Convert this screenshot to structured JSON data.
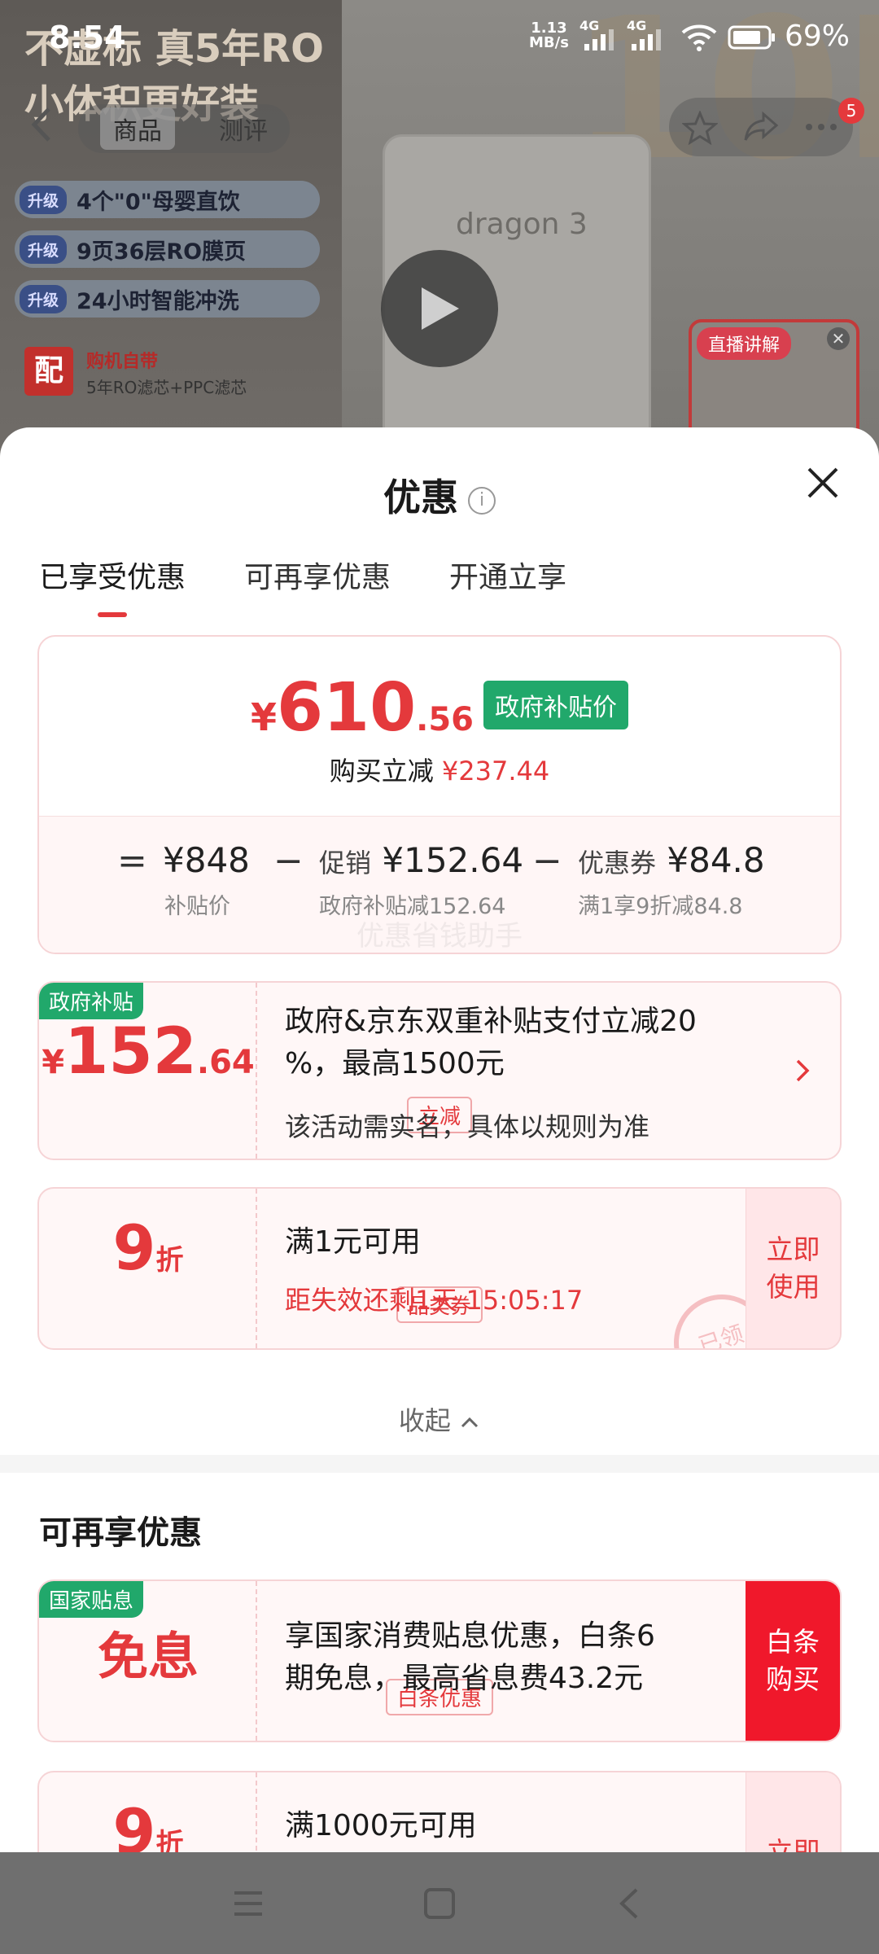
{
  "status_bar": {
    "time": "8:54",
    "net_speed": "1.13",
    "net_unit": "MB/s",
    "signal1": "4G",
    "signal2": "4G",
    "battery": "69%"
  },
  "product": {
    "poster_title_1": "不虚标 真5年RO",
    "poster_title_2": "小体积更好装",
    "features": [
      {
        "tag": "升级",
        "text": "4个\"0\"母婴直饮"
      },
      {
        "tag": "升级",
        "text": "9页36层RO膜页"
      },
      {
        "tag": "升级",
        "text": "24小时智能冲洗"
      }
    ],
    "gift_mark": "配",
    "gift_line1": "购机自带",
    "gift_line2": "5年RO滤芯+PPC滤芯",
    "device_label": "dragon 3",
    "nav_tabs": [
      "商品",
      "测评"
    ],
    "cart_badge": "5",
    "live_tag": "直播讲解"
  },
  "sheet": {
    "title": "优惠",
    "info_icon": "i",
    "tabs": [
      "已享受优惠",
      "可再享优惠",
      "开通立享"
    ],
    "active_tab": 0
  },
  "price": {
    "yen": "¥",
    "integer": "610",
    "decimal": ".56",
    "badge": "政府补贴价",
    "reduce_label": "购买立减",
    "reduce_amount": "¥237.44",
    "eq": "=",
    "minus": "−",
    "base_value": "¥848",
    "base_label": "补贴价",
    "promo_prefix": "促销",
    "promo_value": "¥152.64",
    "promo_label": "政府补贴减152.64",
    "coupon_prefix": "优惠券",
    "coupon_value": "¥84.8",
    "coupon_label": "满1享9折减84.8",
    "watermark": "优惠省钱助手"
  },
  "coupons": [
    {
      "tag": "政府补贴",
      "yen": "¥",
      "value_int": "152",
      "value_dec": ".64",
      "sub": "立减",
      "desc_line1": "政府&京东双重补贴支付立减20",
      "desc_line2": "%，最高1500元",
      "note": "该活动需实名，具体以规则为准"
    },
    {
      "value_int": "9",
      "value_unit": "折",
      "sub": "品类券",
      "desc": "满1元可用",
      "note": "距失效还剩1天 15:05:17",
      "action_1": "立即",
      "action_2": "使用",
      "stamp": "已领"
    }
  ],
  "collapse_label": "收起",
  "more_section": {
    "title": "可再享优惠",
    "items": [
      {
        "tag": "国家贴息",
        "value": "免息",
        "sub": "白条优惠",
        "desc_line1": "享国家消费贴息优惠，白条6",
        "desc_line2": "期免息，最高省息费43.2元",
        "action_1": "白条",
        "action_2": "购买"
      },
      {
        "value_int": "9",
        "value_unit": "折",
        "desc": "满1000元可用",
        "action_1": "立即"
      }
    ]
  },
  "colors": {
    "accent_red": "#e4393c",
    "gov_green": "#21a86b",
    "action_red": "#f0182b"
  }
}
